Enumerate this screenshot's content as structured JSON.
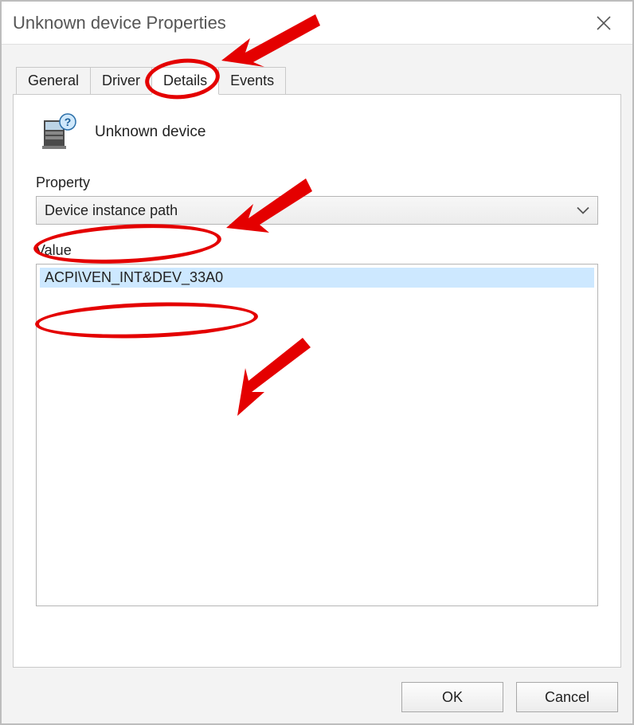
{
  "window": {
    "title": "Unknown device Properties"
  },
  "tabs": {
    "general": "General",
    "driver": "Driver",
    "details": "Details",
    "events": "Events",
    "active": "details"
  },
  "details": {
    "device_name": "Unknown device",
    "property_label": "Property",
    "property_value": "Device instance path",
    "value_label": "Value",
    "value_row": "ACPI\\VEN_INT&DEV_33A0"
  },
  "buttons": {
    "ok": "OK",
    "cancel": "Cancel"
  },
  "annotations": {
    "circles": [
      {
        "name": "circle-details-tab"
      },
      {
        "name": "circle-property-dropdown"
      },
      {
        "name": "circle-value-row"
      }
    ],
    "arrows": [
      {
        "name": "arrow-to-details-tab"
      },
      {
        "name": "arrow-to-property-dropdown"
      },
      {
        "name": "arrow-to-value-row"
      }
    ],
    "color": "#e40000"
  }
}
